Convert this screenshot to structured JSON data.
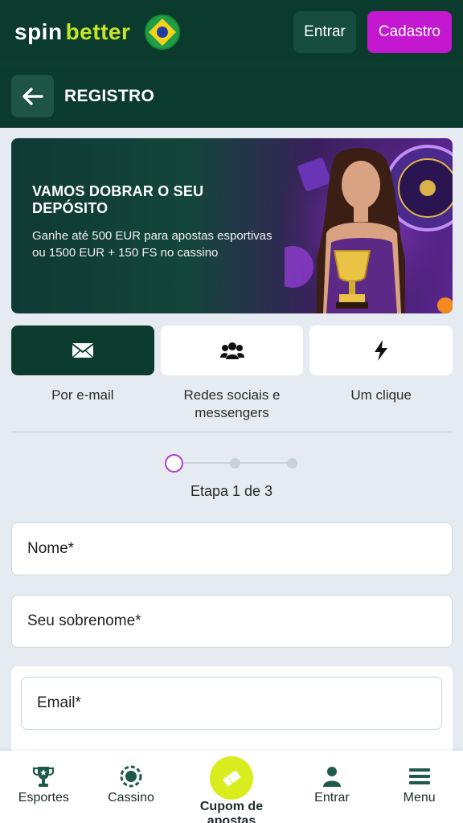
{
  "header": {
    "logo_part1": "spin",
    "logo_part2": "better",
    "flag_icon": "brazil-flag-icon",
    "login_label": "Entrar",
    "signup_label": "Cadastro"
  },
  "titlebar": {
    "back_icon": "arrow-left-icon",
    "title": "REGISTRO"
  },
  "banner": {
    "title": "VAMOS DOBRAR O SEU DEPÓSITO",
    "description": "Ganhe até 500 EUR para apostas esportivas ou 1500 EUR + 150 FS no cassino"
  },
  "registration_tabs": [
    {
      "label": "Por e-mail",
      "icon": "envelope-icon",
      "active": true
    },
    {
      "label": "Redes sociais e messengers",
      "icon": "users-icon",
      "active": false
    },
    {
      "label": "Um clique",
      "icon": "lightning-icon",
      "active": false
    }
  ],
  "steps": {
    "label": "Etapa 1 de 3",
    "current": 1,
    "total": 3
  },
  "form": {
    "name_placeholder": "Nome*",
    "surname_placeholder": "Seu sobrenome*",
    "email_placeholder": "Email*"
  },
  "bottom_nav": [
    {
      "label": "Esportes",
      "icon": "trophy-icon"
    },
    {
      "label": "Cassino",
      "icon": "casino-chip-icon"
    },
    {
      "label": "Cupom de apostas",
      "icon": "ticket-icon"
    },
    {
      "label": "Entrar",
      "icon": "user-icon"
    },
    {
      "label": "Menu",
      "icon": "hamburger-menu-icon"
    }
  ],
  "colors": {
    "header_bg": "#0b3b2d",
    "signup_button": "#c418d0",
    "brand_lime": "#c6e52a",
    "coupon_accent": "#d9ed1e",
    "step_active": "#b23ad1"
  }
}
